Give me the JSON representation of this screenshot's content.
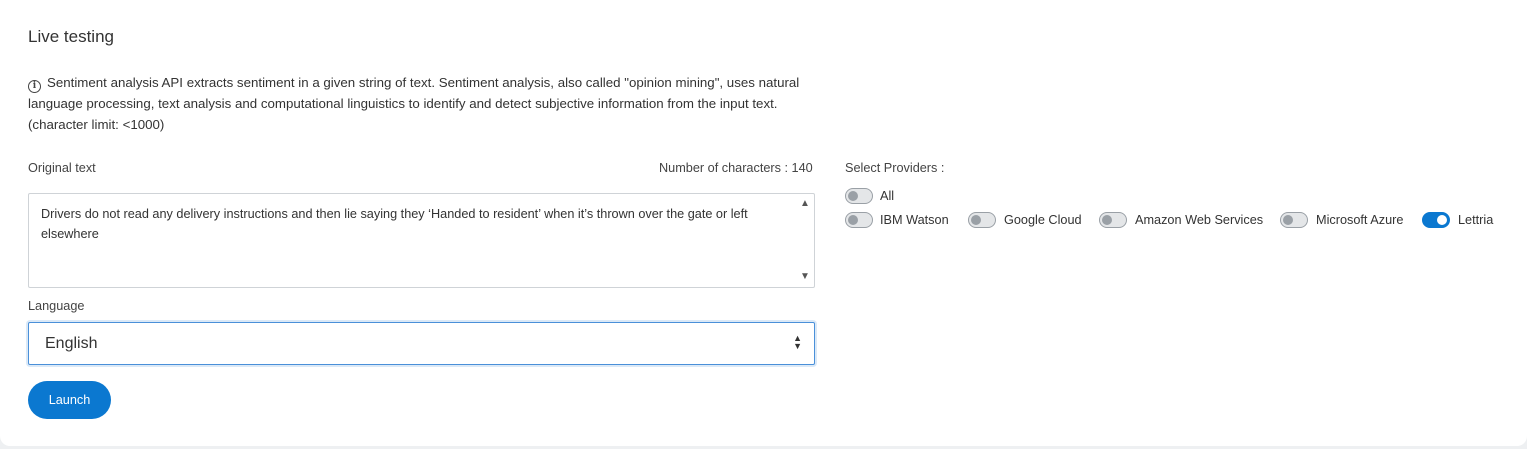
{
  "title": "Live testing",
  "info": {
    "icon": "info-icon",
    "text": "Sentiment analysis API extracts sentiment in a given string of text. Sentiment analysis, also called \"opinion mining\", uses natural language processing, text analysis and computational linguistics to identify and detect subjective information from the input text. (character limit: <1000)"
  },
  "original_text": {
    "label": "Original text",
    "char_count_label": "Number of characters : 140",
    "value": "Drivers do not read any delivery instructions and then lie saying they ‘Handed to resident’ when it’s thrown over the gate or left elsewhere"
  },
  "language": {
    "label": "Language",
    "selected": "English"
  },
  "launch_label": "Launch",
  "providers": {
    "label": "Select Providers :",
    "all": {
      "label": "All",
      "checked": false
    },
    "items": [
      {
        "label": "IBM Watson",
        "checked": false
      },
      {
        "label": "Google Cloud",
        "checked": false
      },
      {
        "label": "Amazon Web Services",
        "checked": false
      },
      {
        "label": "Microsoft Azure",
        "checked": false
      },
      {
        "label": "Lettria",
        "checked": true
      }
    ]
  },
  "colors": {
    "accent": "#0b78d0",
    "toggle_off": "#9aa0a6"
  }
}
